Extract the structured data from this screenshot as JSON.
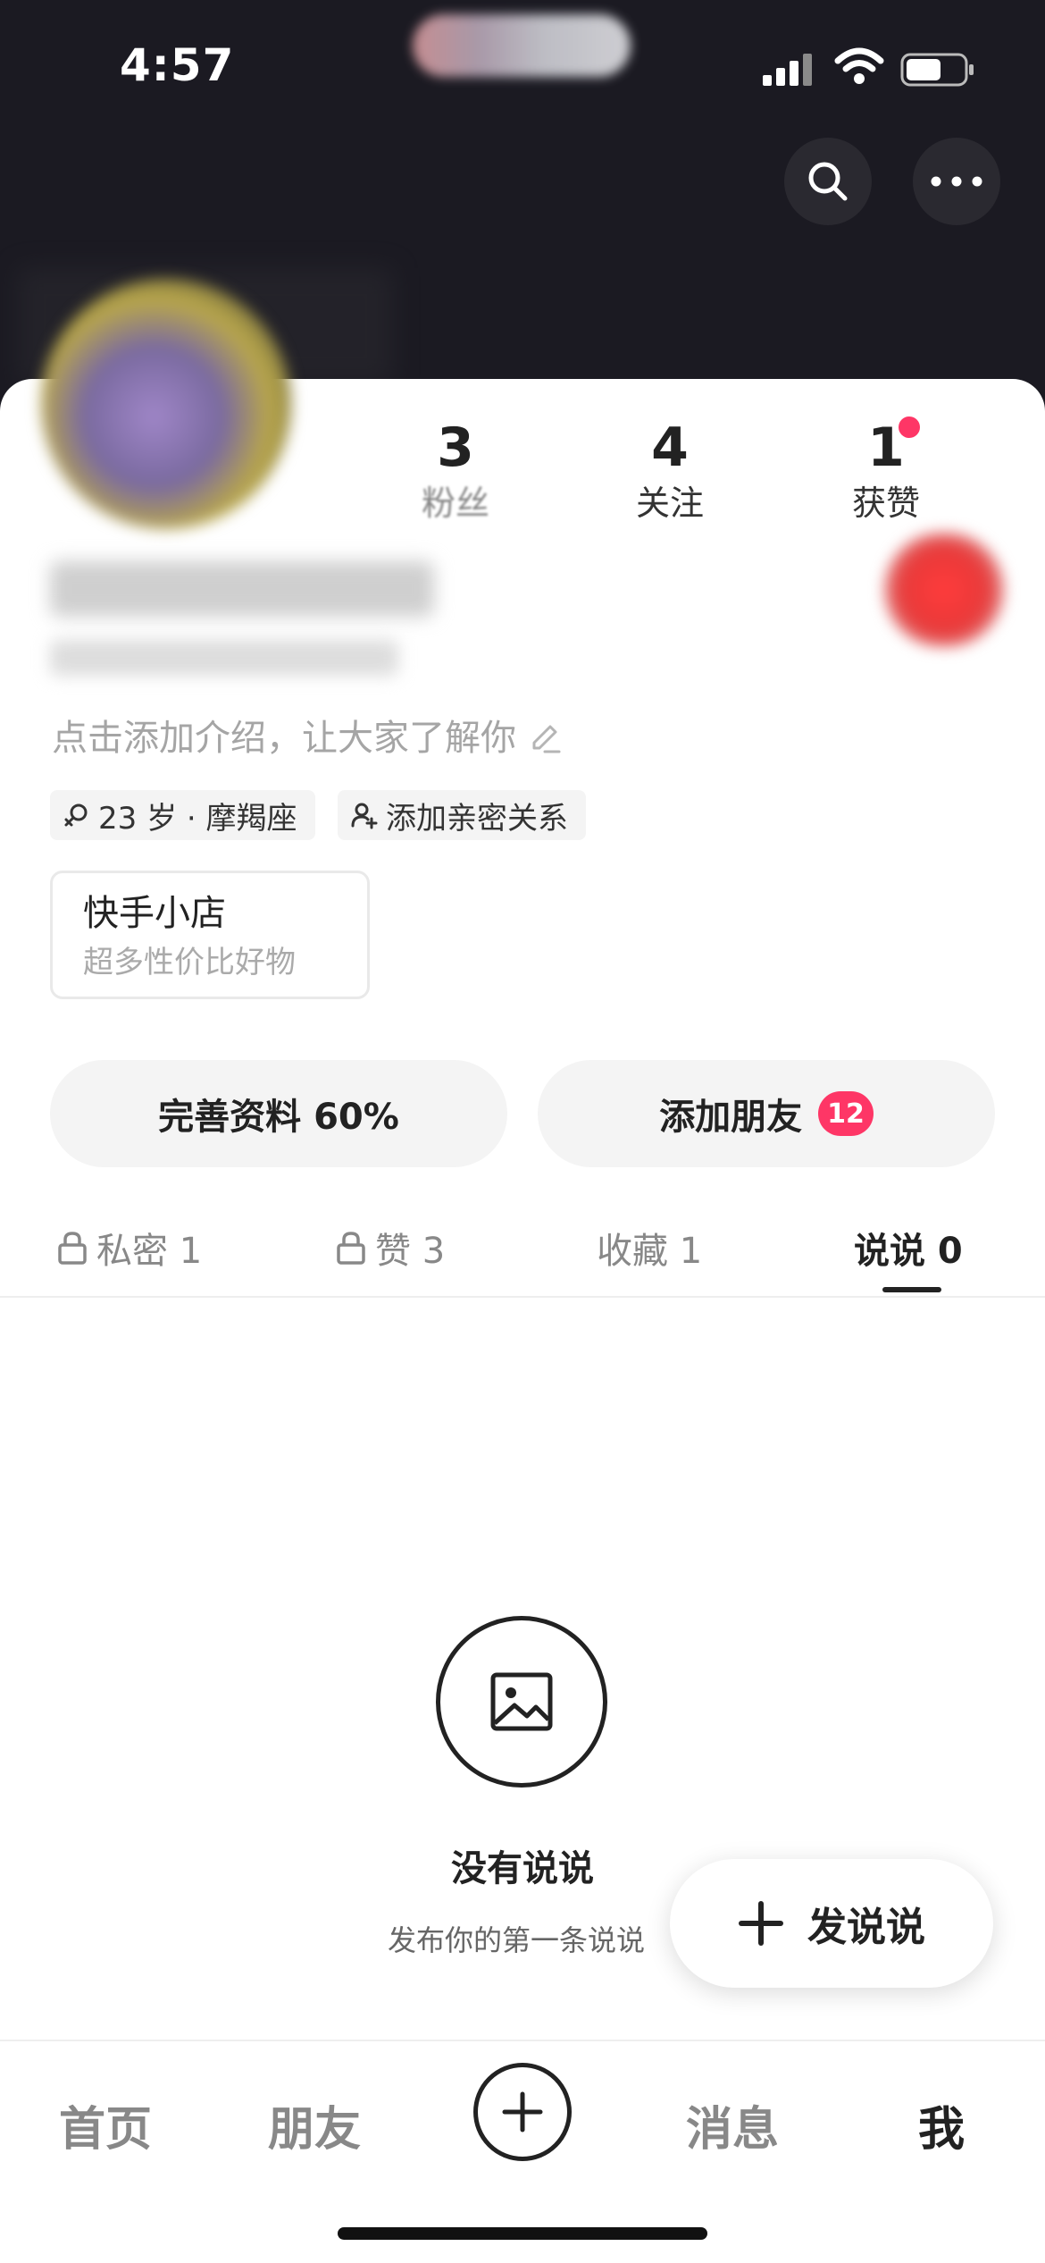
{
  "status_bar": {
    "time": "4:57"
  },
  "header": {
    "search_icon": "search-icon",
    "more_icon": "more-dots-icon"
  },
  "stats": [
    {
      "value": "3",
      "label": "粉丝"
    },
    {
      "value": "4",
      "label": "关注"
    },
    {
      "value": "1",
      "label": "获赞"
    }
  ],
  "profile": {
    "intro": "点击添加介绍，让大家了解你",
    "tags": {
      "age": "23 岁 · 摩羯座",
      "relation": "添加亲密关系"
    },
    "shop": {
      "title": "快手小店",
      "subtitle": "超多性价比好物"
    }
  },
  "actions": {
    "complete_profile": "完善资料 60%",
    "add_friends": "添加朋友",
    "add_friends_badge": "12"
  },
  "tabs": [
    {
      "label": "私密 1",
      "locked": true
    },
    {
      "label": "赞 3",
      "locked": true
    },
    {
      "label": "收藏 1",
      "locked": false
    },
    {
      "label": "说说 0",
      "locked": false,
      "active": true
    }
  ],
  "empty_state": {
    "title": "没有说说",
    "subtitle": "发布你的第一条说说"
  },
  "fab": {
    "label": "发说说"
  },
  "bottom_nav": {
    "home": "首页",
    "friends": "朋友",
    "messages": "消息",
    "me": "我"
  },
  "colors": {
    "accent": "#fe3666",
    "header_bg": "#1b1a22",
    "pill_bg": "#f4f4f4"
  }
}
